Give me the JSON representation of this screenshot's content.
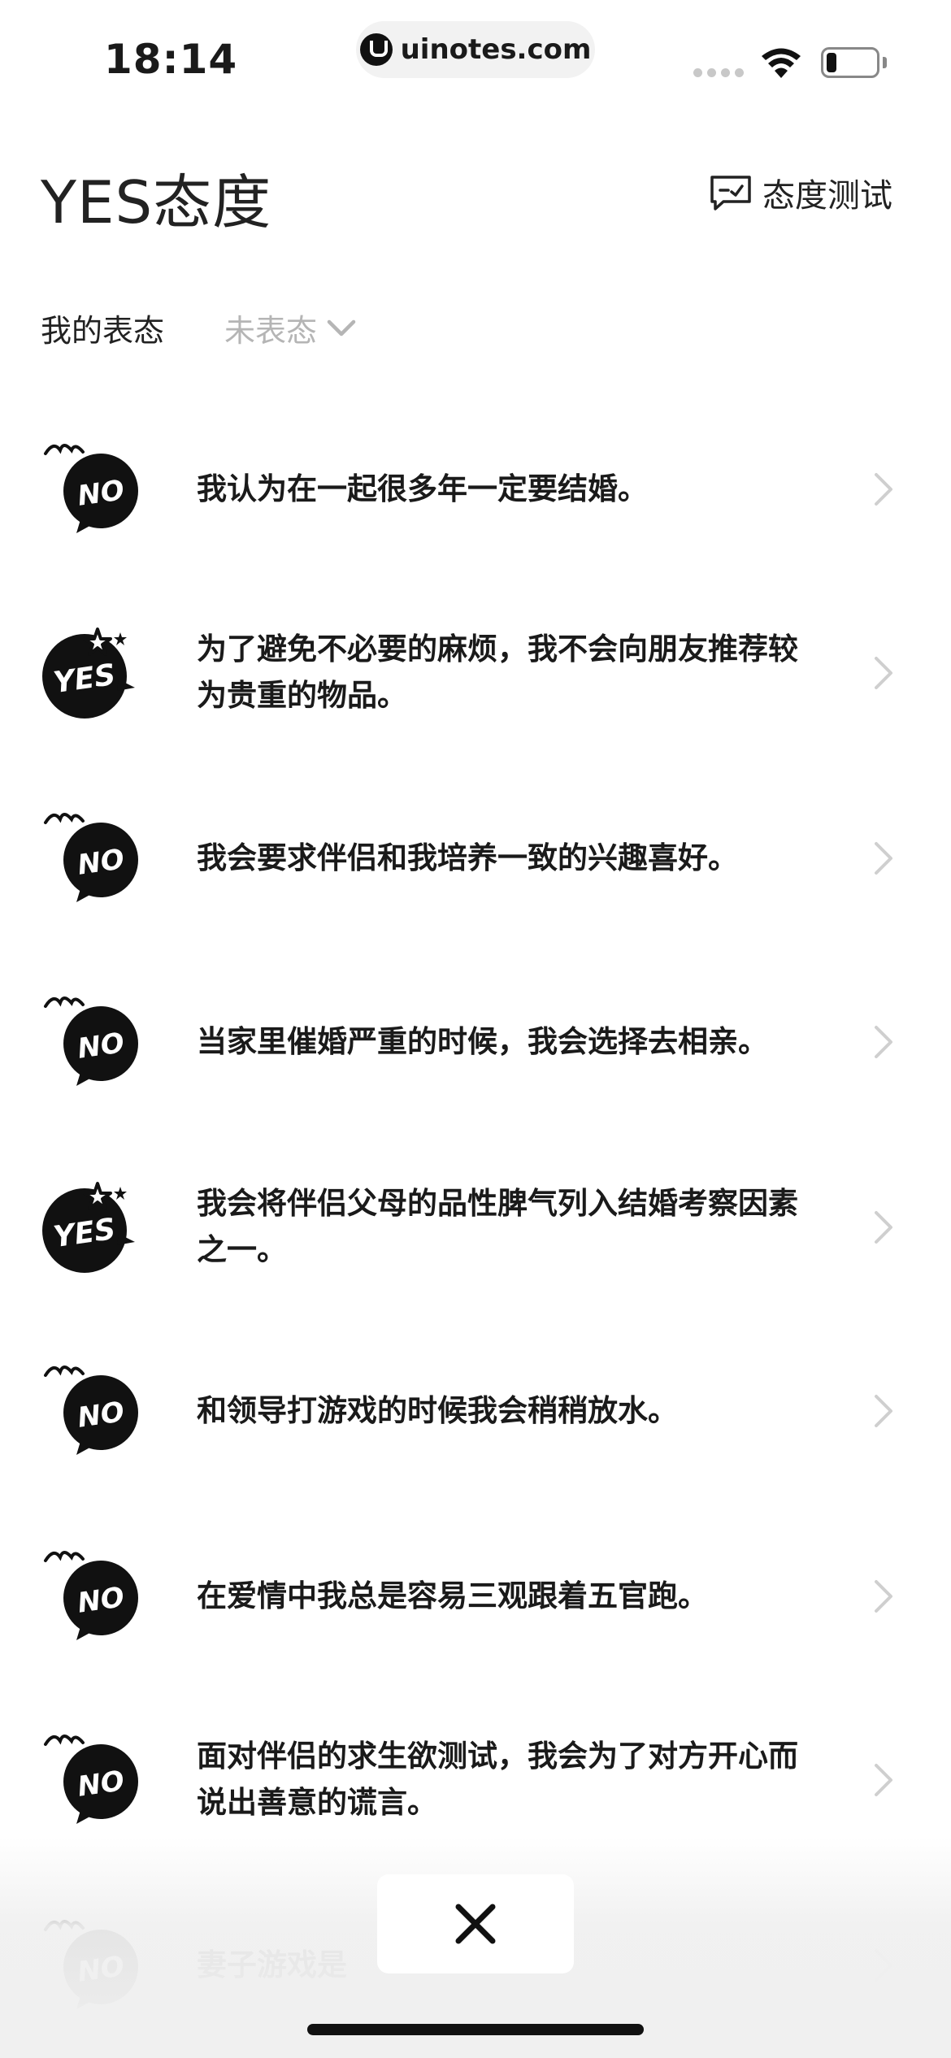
{
  "status_bar": {
    "time": "18:14",
    "url": "uinotes.com",
    "battery_level": 0.2
  },
  "header": {
    "title": "YES态度",
    "test_link_label": "态度测试",
    "test_icon": "chat-check-icon"
  },
  "stance": {
    "label": "我的表态",
    "value": "未表态",
    "dropdown_icon": "chevron-down-icon"
  },
  "statements": [
    {
      "badge": "NO",
      "text": "我认为在一起很多年一定要结婚。"
    },
    {
      "badge": "YES",
      "text": "为了避免不必要的麻烦，我不会向朋友推荐较为贵重的物品。"
    },
    {
      "badge": "NO",
      "text": "我会要求伴侣和我培养一致的兴趣喜好。"
    },
    {
      "badge": "NO",
      "text": "当家里催婚严重的时候，我会选择去相亲。"
    },
    {
      "badge": "YES",
      "text": "我会将伴侣父母的品性脾气列入结婚考察因素之一。"
    },
    {
      "badge": "NO",
      "text": "和领导打游戏的时候我会稍稍放水。"
    },
    {
      "badge": "NO",
      "text": "在爱情中我总是容易三观跟着五官跑。"
    },
    {
      "badge": "NO",
      "text": "面对伴侣的求生欲测试，我会为了对方开心而说出善意的谎言。"
    },
    {
      "badge": "NO",
      "text": "妻子游戏是"
    }
  ],
  "colors": {
    "text": "#1a1a1a",
    "muted": "#b5b5b5",
    "chevron": "#cfcfcf",
    "badge": "#111111"
  },
  "icons": {
    "close": "close-icon",
    "row_chevron": "chevron-right-icon"
  }
}
